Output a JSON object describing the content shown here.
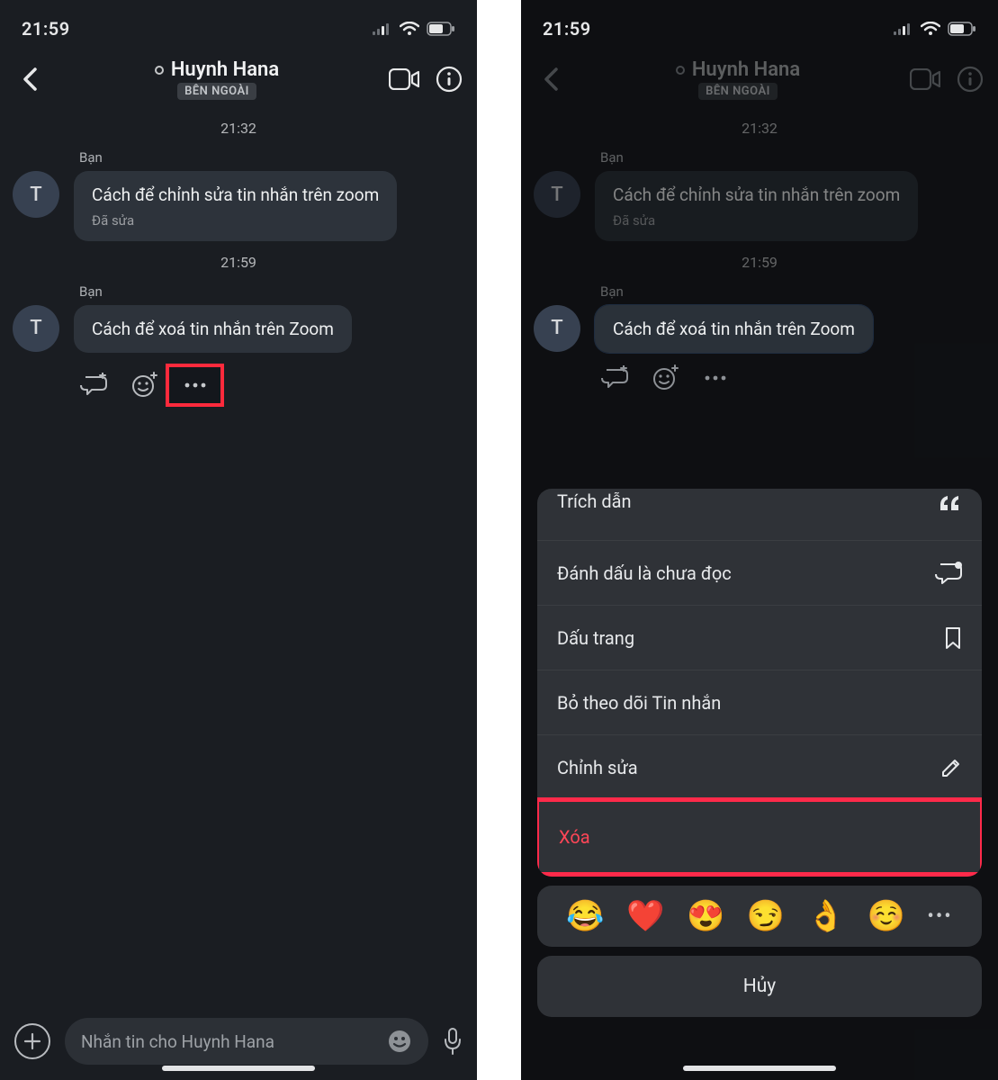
{
  "statusbar": {
    "time": "21:59"
  },
  "header": {
    "contact_name": "Huynh Hana",
    "external_badge": "BÊN NGOÀI"
  },
  "chat": {
    "timestamps": [
      "21:32",
      "21:59"
    ],
    "sender_label": "Bạn",
    "avatar_letter": "T",
    "messages": [
      {
        "text": "Cách để chỉnh sửa tin nhắn trên zoom",
        "edited": "Đã sửa"
      },
      {
        "text": "Cách để xoá tin nhắn trên Zoom"
      }
    ]
  },
  "composer": {
    "placeholder": "Nhắn tin cho Huynh Hana"
  },
  "menu": {
    "items": [
      {
        "label": "Trích dẫn",
        "icon": "quote"
      },
      {
        "label": "Đánh dấu là chưa đọc",
        "icon": "chat-unread"
      },
      {
        "label": "Dấu trang",
        "icon": "bookmark"
      },
      {
        "label": "Bỏ theo dõi Tin nhắn",
        "icon": ""
      },
      {
        "label": "Chỉnh sửa",
        "icon": "pencil"
      },
      {
        "label": "Xóa",
        "icon": "",
        "danger": true
      }
    ],
    "cancel": "Hủy",
    "reactions": [
      "😂",
      "❤️",
      "😍",
      "😏",
      "👌",
      "☺️"
    ]
  }
}
